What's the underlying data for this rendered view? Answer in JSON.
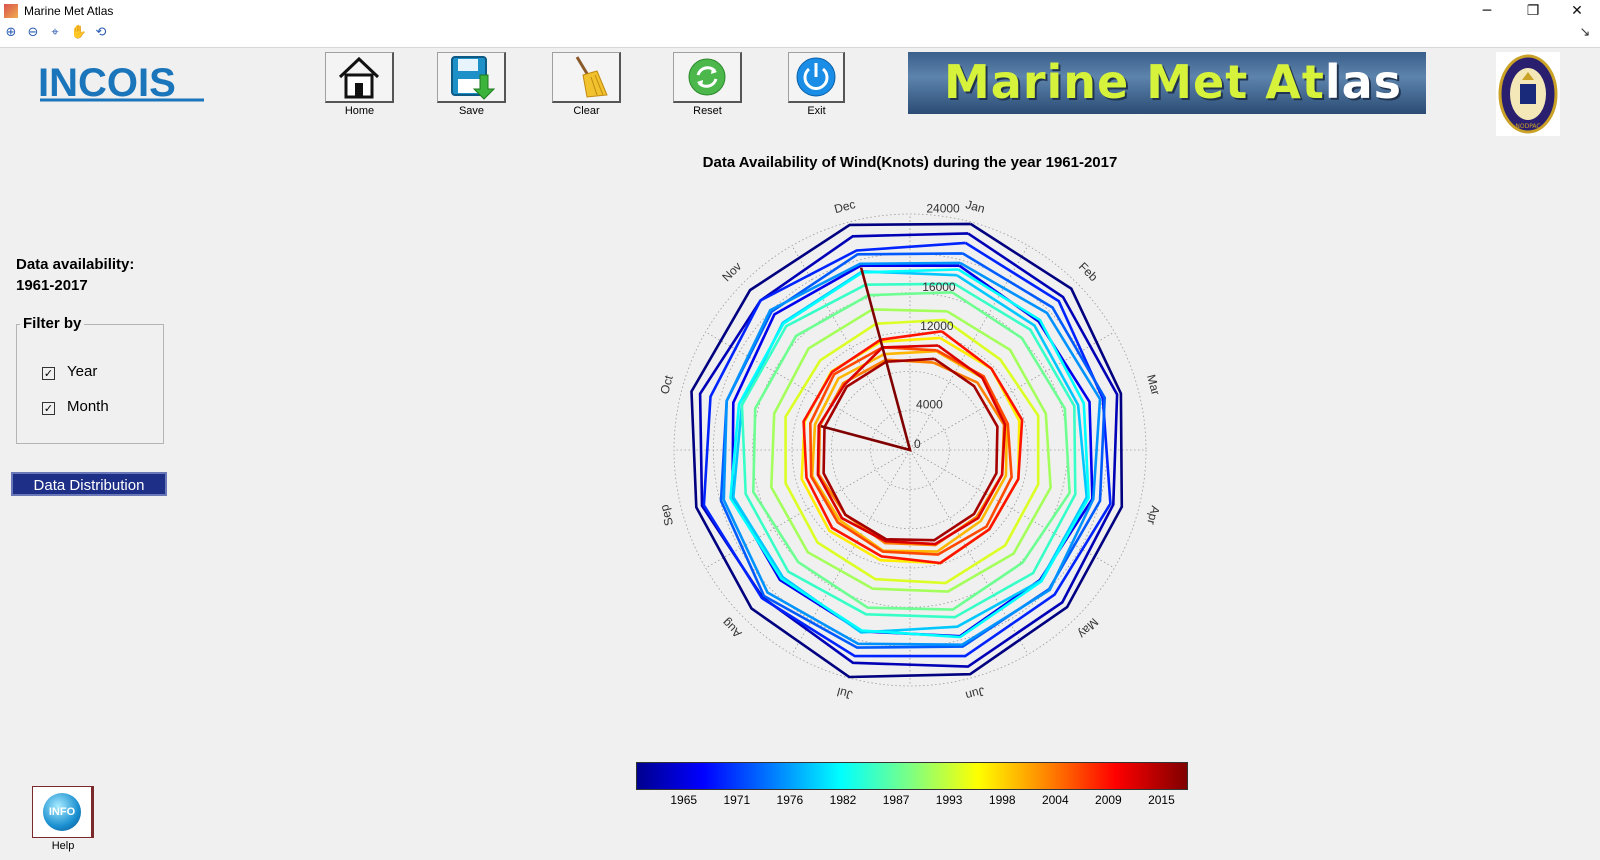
{
  "window": {
    "title": "Marine Met Atlas",
    "minimize": "─",
    "restore": "❐",
    "close": "✕"
  },
  "toolbar": {
    "zoom_in": "⊕",
    "zoom_out": "⊖",
    "data_cursor": "⌖",
    "pan": "✋",
    "rotate": "⟲",
    "dock": "↘"
  },
  "logos": {
    "incois": "INCOIS",
    "emblem_text": "NODPAC"
  },
  "buttons": [
    {
      "label": "Home",
      "icon": "home-icon"
    },
    {
      "label": "Save",
      "icon": "floppy-icon"
    },
    {
      "label": "Clear",
      "icon": "broom-icon"
    },
    {
      "label": "Reset",
      "icon": "refresh-icon"
    },
    {
      "label": "Exit",
      "icon": "power-icon"
    }
  ],
  "banner": {
    "part1": "Marine ",
    "part2": "Met ",
    "part3": "At",
    "part4": "las"
  },
  "left_panel": {
    "availability_label": "Data availability:",
    "availability_range": "1961-2017",
    "filter_title": "Filter by",
    "filters": [
      {
        "label": "Year",
        "checked": true
      },
      {
        "label": "Month",
        "checked": true
      }
    ],
    "distribution_button": "Data Distribution"
  },
  "help": {
    "orb_text": "INFO",
    "label": "Help"
  },
  "chart_data": {
    "type": "polar-line",
    "title": "Data Availability of Wind(Knots) during the year 1961-2017",
    "angular_labels": [
      "Jan",
      "Feb",
      "Mar",
      "Apr",
      "May",
      "Jun",
      "Jul",
      "Aug",
      "Sep",
      "Oct",
      "Nov",
      "Dec"
    ],
    "radial_ticks": [
      0,
      4000,
      12000,
      16000,
      24000
    ],
    "radial_tick_labels": [
      "0",
      "4000",
      "12000",
      "16000",
      "24000"
    ],
    "rlim": [
      0,
      24000
    ],
    "grid": true,
    "colormap": "jet",
    "colorbar_ticks": [
      "1965",
      "1971",
      "1976",
      "1982",
      "1987",
      "1993",
      "1998",
      "2004",
      "2009",
      "2015"
    ],
    "series_range": [
      1961,
      2017
    ],
    "series": [
      {
        "name": "1961",
        "values": [
          23800,
          23200,
          22200,
          22300,
          22600,
          23600,
          23900,
          22800,
          22500,
          23000,
          23000,
          23700
        ]
      },
      {
        "name": "1964",
        "values": [
          22800,
          22000,
          21800,
          21400,
          21900,
          22800,
          22400,
          21200,
          21900,
          22100,
          21500,
          22500
        ]
      },
      {
        "name": "1967",
        "values": [
          19400,
          18500,
          18900,
          19200,
          18700,
          19600,
          19100,
          18700,
          18700,
          18600,
          19500,
          19400
        ]
      },
      {
        "name": "1970",
        "values": [
          21800,
          21400,
          20300,
          21100,
          20800,
          21700,
          21700,
          21300,
          21700,
          21000,
          21500,
          21000
        ]
      },
      {
        "name": "1973",
        "values": [
          20700,
          20500,
          20500,
          20000,
          20000,
          20700,
          20800,
          21000,
          19900,
          19300,
          19900,
          20600
        ]
      },
      {
        "name": "1976",
        "values": [
          19700,
          19700,
          20000,
          19300,
          20100,
          20500,
          20400,
          20500,
          19600,
          19300,
          20100,
          19600
        ]
      },
      {
        "name": "1979",
        "values": [
          18400,
          17900,
          17700,
          18600,
          18800,
          18600,
          19200,
          18300,
          18600,
          17700,
          18300,
          18800
        ]
      },
      {
        "name": "1982",
        "values": [
          19000,
          18700,
          18300,
          18800,
          18900,
          19700,
          19000,
          18500,
          18900,
          18000,
          18200,
          18700
        ]
      },
      {
        "name": "1985",
        "values": [
          17500,
          17300,
          17300,
          17400,
          17700,
          17600,
          17300,
          17500,
          17300,
          17700,
          17800,
          17400
        ]
      },
      {
        "name": "1988",
        "values": [
          16600,
          16100,
          16300,
          16800,
          16200,
          16800,
          16600,
          16100,
          16500,
          16300,
          16400,
          16300
        ]
      },
      {
        "name": "1991",
        "values": [
          14600,
          14400,
          14300,
          14800,
          14900,
          14900,
          14600,
          14700,
          14600,
          14300,
          14600,
          14800
        ]
      },
      {
        "name": "1994",
        "values": [
          13700,
          13000,
          13500,
          13500,
          13700,
          14000,
          13600,
          13300,
          13100,
          13100,
          12900,
          13300
        ]
      },
      {
        "name": "1997",
        "values": [
          11800,
          11700,
          11500,
          11400,
          11400,
          11900,
          11600,
          11600,
          11400,
          11100,
          11300,
          11400
        ]
      },
      {
        "name": "2000",
        "values": [
          10400,
          10400,
          10200,
          10100,
          10200,
          10700,
          10600,
          10100,
          10300,
          10000,
          10300,
          10100
        ]
      },
      {
        "name": "2003",
        "values": [
          9200,
          9700,
          9900,
          9700,
          9600,
          10000,
          9800,
          9300,
          9600,
          9500,
          9600,
          9500
        ]
      },
      {
        "name": "2006",
        "values": [
          10500,
          10600,
          10300,
          10700,
          11000,
          11000,
          10700,
          10400,
          10400,
          10500,
          10900,
          10800
        ]
      },
      {
        "name": "2009",
        "values": [
          12500,
          11700,
          11800,
          11400,
          11400,
          11900,
          11200,
          11200,
          10900,
          11200,
          11200,
          11600
        ]
      },
      {
        "name": "2012",
        "values": [
          11000,
          10400,
          10000,
          9700,
          9800,
          9900,
          9600,
          9800,
          9700,
          9600,
          9400,
          10800
        ]
      },
      {
        "name": "2015",
        "values": [
          9600,
          9200,
          9200,
          9100,
          9200,
          9500,
          9400,
          9300,
          9100,
          9000,
          9100,
          9300
        ]
      },
      {
        "name": "2017",
        "values": [
          0,
          0,
          0,
          0,
          0,
          0,
          0,
          0,
          0,
          9400,
          0,
          19200
        ]
      }
    ]
  }
}
